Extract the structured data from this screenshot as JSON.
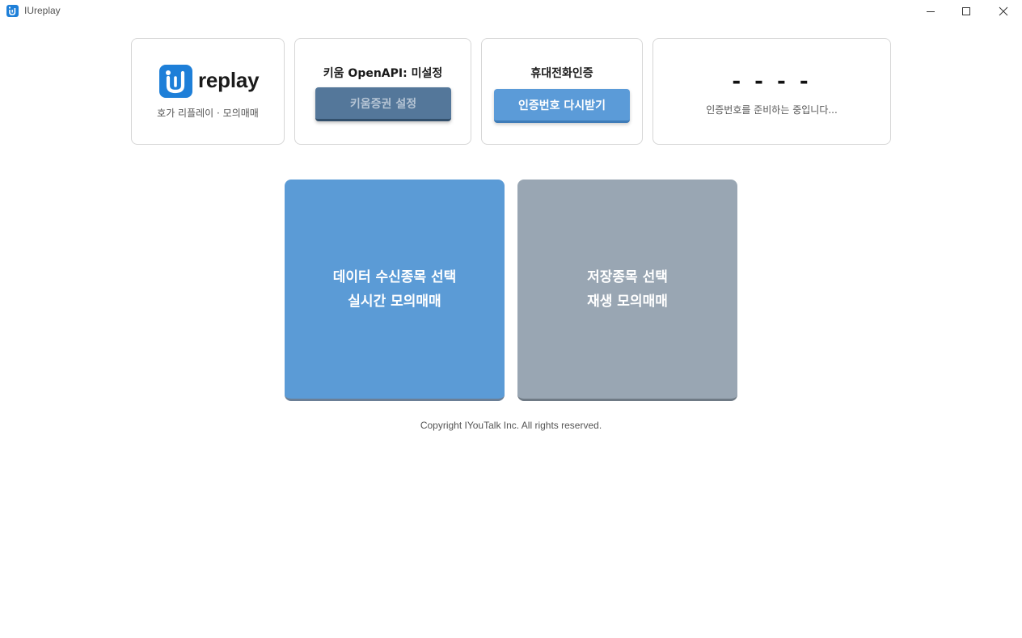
{
  "window": {
    "title": "IUreplay",
    "icon": "app-logo-icon",
    "controls": [
      "minimize-icon",
      "maximize-icon",
      "close-icon"
    ]
  },
  "brand": {
    "logo_icon": "iu-logo-icon",
    "logo_text": "replay",
    "subtitle": "호가 리플레이 · 모의매매",
    "accent_color": "#1e7fd8"
  },
  "api_card": {
    "title": "키움 OpenAPI: 미설정",
    "button_label": "키움증권 설정"
  },
  "phone_card": {
    "title": "휴대전화인증",
    "button_label": "인증번호 다시받기"
  },
  "code_card": {
    "code": "- - - -",
    "status": "인증번호를 준비하는 중입니다..."
  },
  "tiles": {
    "live": {
      "line1": "데이터 수신종목 선택",
      "line2": "실시간 모의매매",
      "color": "#5b9bd6"
    },
    "replay": {
      "line1": "저장종목 선택",
      "line2": "재생 모의매매",
      "color": "#99a6b3"
    }
  },
  "footer": {
    "copyright": "Copyright IYouTalk Inc. All rights reserved."
  }
}
